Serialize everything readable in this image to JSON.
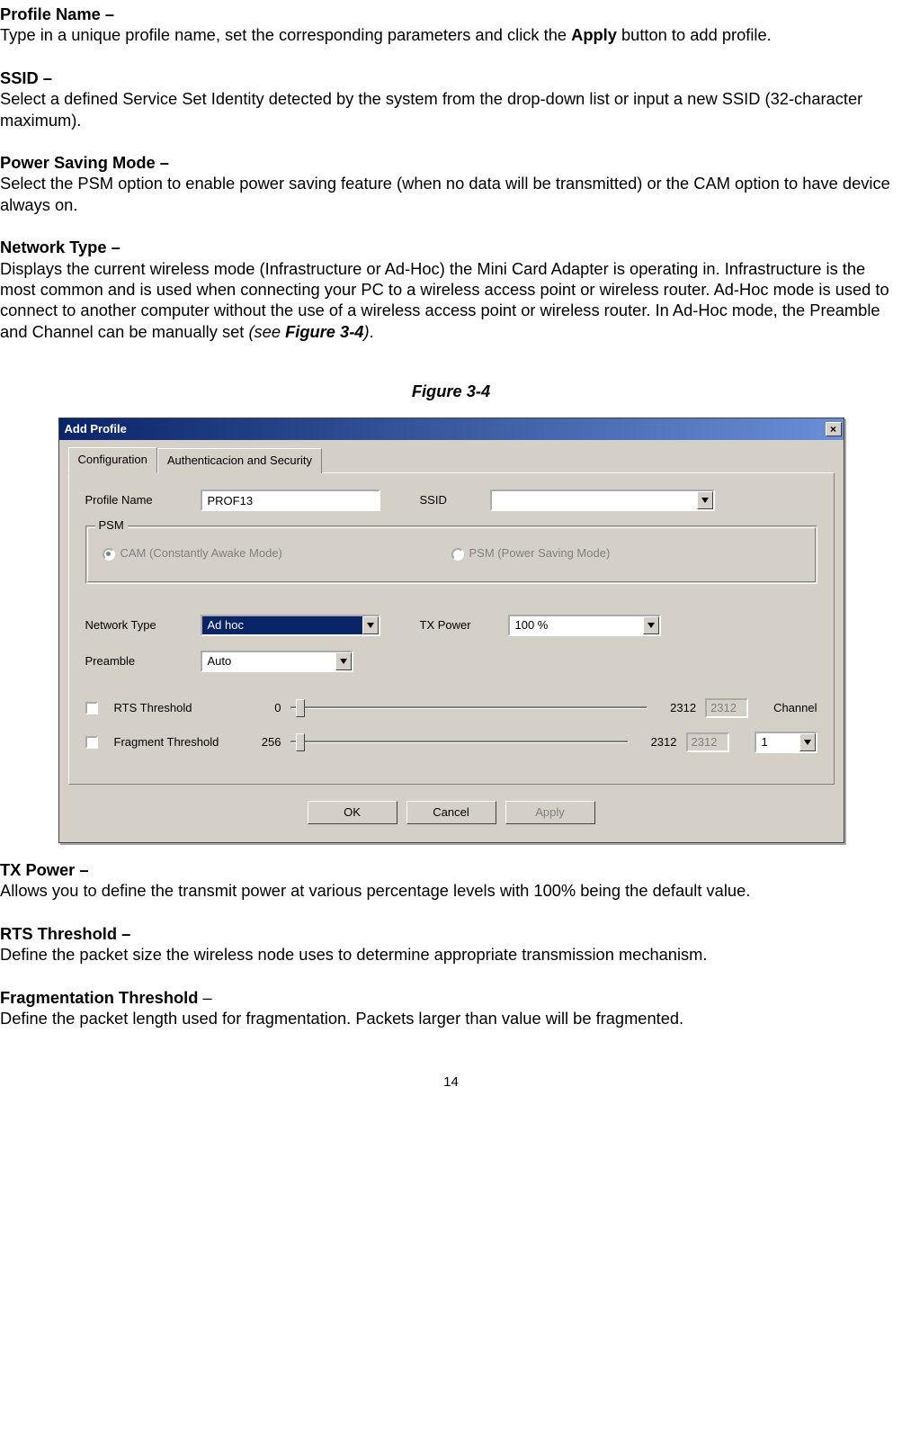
{
  "text": {
    "profile_name_h": "Profile Name –",
    "profile_name_b_a": "Type in a unique profile name, set the corresponding parameters and click the ",
    "profile_name_b_b": "Apply",
    "profile_name_b_c": " button to add profile.",
    "ssid_h": "SSID –",
    "ssid_b": "Select a defined Service Set Identity detected by the system from the drop-down list or input a new SSID (32-character maximum).",
    "psm_h": "Power Saving Mode –",
    "psm_b": "Select the PSM option to enable power saving feature (when no data will be transmitted) or the CAM option to have device always on.",
    "net_h": "Network Type –",
    "net_b_a": "Displays the current wireless mode (Infrastructure or Ad-Hoc) the Mini Card Adapter is operating in. Infrastructure is the most common and is used when connecting your PC to a wireless access point or wireless router.    Ad-Hoc mode is used to connect to another computer without the use of a wireless access point or wireless router. In Ad-Hoc mode, the Preamble and Channel can be manually set ",
    "net_b_italic_a": "(see ",
    "net_b_bi": "Figure 3-4",
    "net_b_italic_b": ")",
    "net_b_end": ".",
    "fig_caption": "Figure 3-4",
    "tx_h": "TX Power –",
    "tx_b": "Allows you to define the transmit power at various percentage levels with 100% being the default value.",
    "rts_h": "RTS Threshold –",
    "rts_b": "Define the packet size the wireless node uses to determine appropriate transmission mechanism.",
    "frag_h_a": "Fragmentation Threshold",
    "frag_h_b": " –",
    "frag_b": "Define the packet length used for fragmentation. Packets larger than value will be fragmented.",
    "page_num": "14"
  },
  "dialog": {
    "title": "Add Profile",
    "close_glyph": "×",
    "tabs": {
      "config": "Configuration",
      "auth": "Authenticacion and Security"
    },
    "fields": {
      "profile_name_label": "Profile Name",
      "profile_name_value": "PROF13",
      "ssid_label": "SSID",
      "ssid_value": "",
      "psm_group": "PSM",
      "cam_label": "CAM (Constantly Awake Mode)",
      "psm_label": "PSM (Power Saving Mode)",
      "network_type_label": "Network Type",
      "network_type_value": "Ad hoc",
      "tx_power_label": "TX Power",
      "tx_power_value": "100 %",
      "preamble_label": "Preamble",
      "preamble_value": "Auto",
      "rts_check_label": "RTS Threshold",
      "rts_min": "0",
      "rts_max": "2312",
      "rts_value": "2312",
      "frag_check_label": "Fragment Threshold",
      "frag_min": "256",
      "frag_max": "2312",
      "frag_value": "2312",
      "channel_label": "Channel",
      "channel_value": "1"
    },
    "buttons": {
      "ok": "OK",
      "cancel": "Cancel",
      "apply": "Apply"
    }
  }
}
